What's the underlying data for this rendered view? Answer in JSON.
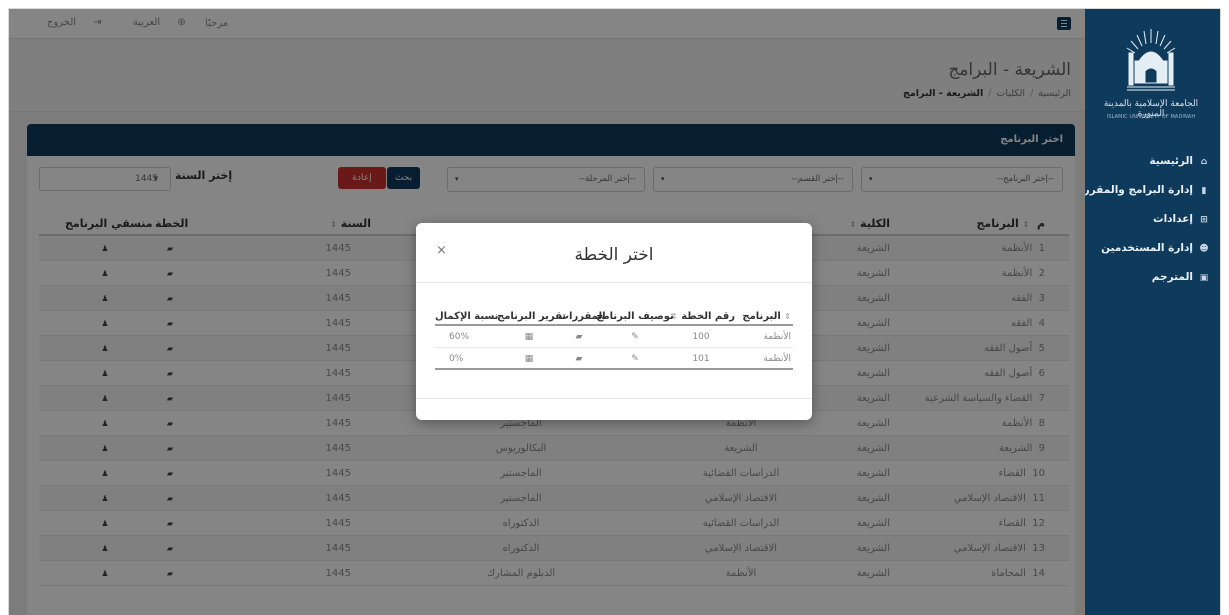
{
  "sidebar": {
    "logo": {
      "name_ar": "الجامعة الإسلامية بالمدينة المنورة",
      "name_en": "ISLAMIC UNIVERSITY OF MADINAH"
    },
    "items": [
      {
        "label": "الرئيسية",
        "icon": "home-icon",
        "glyph": "⌂"
      },
      {
        "label": "إدارة البرامج والمقررات",
        "icon": "book-icon",
        "glyph": "▮"
      },
      {
        "label": "إعدادات",
        "icon": "settings-icon",
        "glyph": "⊞"
      },
      {
        "label": "إدارة المستخدمين",
        "icon": "users-icon",
        "glyph": "☻"
      },
      {
        "label": "المترجم",
        "icon": "translate-icon",
        "glyph": "▣"
      }
    ]
  },
  "topbar": {
    "greeting": "مرحبًا",
    "language": "العربية",
    "logout": "الخروج",
    "globe_glyph": "⊕",
    "logout_glyph": "⇥"
  },
  "page": {
    "title": "الشريعة - البرامج",
    "breadcrumb": [
      "الرئيسية",
      "الكليات",
      "الشريعة - البرامج"
    ]
  },
  "panel": {
    "title": "اختر البرنامج",
    "filters": {
      "program": "--إختر البرنامج--",
      "department": "--إختر القسم--",
      "stage": "--إختر المرحلة--",
      "search_button": "بحث",
      "reset_button": "إعادة تعيين",
      "year_label": "إختر السنة",
      "year_value": "1445"
    },
    "columns": {
      "index": "م",
      "program": "البرنامج",
      "faculty": "الكلية",
      "year": "السنة",
      "plan": "الخطة",
      "coordinators": "منسقي البرنامج"
    },
    "rows": [
      {
        "n": "1",
        "program": "الأنظمة",
        "faculty": "الشريعة",
        "department": "",
        "degree": "",
        "year": "1445"
      },
      {
        "n": "2",
        "program": "الأنظمة",
        "faculty": "الشريعة",
        "department": "",
        "degree": "",
        "year": "1445"
      },
      {
        "n": "3",
        "program": "الفقه",
        "faculty": "الشريعة",
        "department": "",
        "degree": "",
        "year": "1445"
      },
      {
        "n": "4",
        "program": "الفقه",
        "faculty": "الشريعة",
        "department": "",
        "degree": "",
        "year": "1445"
      },
      {
        "n": "5",
        "program": "أصول الفقه",
        "faculty": "الشريعة",
        "department": "",
        "degree": "",
        "year": "1445"
      },
      {
        "n": "6",
        "program": "أصول الفقه",
        "faculty": "الشريعة",
        "department": "",
        "degree": "",
        "year": "1445"
      },
      {
        "n": "7",
        "program": "القضاء والسياسة الشرعية",
        "faculty": "الشريعة",
        "department": "",
        "degree": "",
        "year": "1445"
      },
      {
        "n": "8",
        "program": "الأنظمة",
        "faculty": "الشريعة",
        "department": "الأنظمة",
        "degree": "الماجستير",
        "year": "1445"
      },
      {
        "n": "9",
        "program": "الشريعة",
        "faculty": "الشريعة",
        "department": "الشريعة",
        "degree": "البكالوريوس",
        "year": "1445"
      },
      {
        "n": "10",
        "program": "القضاء",
        "faculty": "الشريعة",
        "department": "الدراسات القضائية",
        "degree": "الماجستير",
        "year": "1445"
      },
      {
        "n": "11",
        "program": "الاقتصاد الإسلامي",
        "faculty": "الشريعة",
        "department": "الاقتصاد الإسلامي",
        "degree": "الماجستير",
        "year": "1445"
      },
      {
        "n": "12",
        "program": "القضاء",
        "faculty": "الشريعة",
        "department": "الدراسات القضائية",
        "degree": "الدكتوراه",
        "year": "1445"
      },
      {
        "n": "13",
        "program": "الاقتصاد الإسلامي",
        "faculty": "الشريعة",
        "department": "الاقتصاد الإسلامي",
        "degree": "الدكتوراه",
        "year": "1445"
      },
      {
        "n": "14",
        "program": "المحاماة",
        "faculty": "الشريعة",
        "department": "الأنظمة",
        "degree": "الدبلوم المشارك",
        "year": "1445"
      }
    ]
  },
  "modal": {
    "title": "اختر الخطة",
    "close": "×",
    "columns": {
      "program": "البرنامج",
      "plan_no": "رقم الخطة",
      "description": "توصيف البرنامج",
      "courses": "المقررات",
      "report": "تقرير البرنامج",
      "completion": "نسبة الإكمال"
    },
    "rows": [
      {
        "program": "الأنظمة",
        "plan_no": "100",
        "completion": "60%"
      },
      {
        "program": "الأنظمة",
        "plan_no": "101",
        "completion": "0%"
      }
    ]
  },
  "glyphs": {
    "sort": "⇕",
    "caret": "▾",
    "edit": "✎",
    "book": "▰",
    "report": "▦",
    "user": "♟"
  },
  "colors": {
    "navy": "#0e3a5c",
    "reset": "#c9302c"
  }
}
